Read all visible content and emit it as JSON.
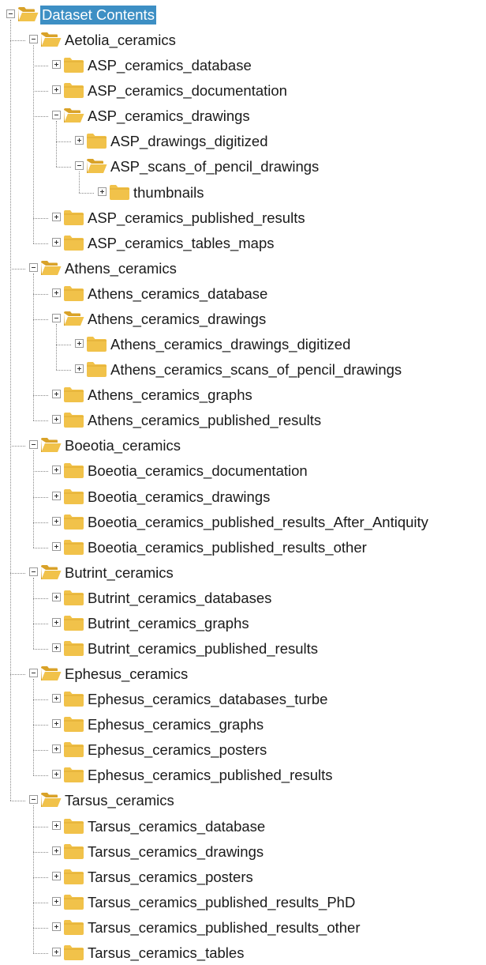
{
  "tree": {
    "label": "Dataset Contents",
    "expanded": true,
    "selected": true,
    "children": [
      {
        "label": "Aetolia_ceramics",
        "expanded": true,
        "children": [
          {
            "label": "ASP_ceramics_database"
          },
          {
            "label": "ASP_ceramics_documentation"
          },
          {
            "label": "ASP_ceramics_drawings",
            "expanded": true,
            "children": [
              {
                "label": "ASP_drawings_digitized"
              },
              {
                "label": "ASP_scans_of_pencil_drawings",
                "expanded": true,
                "children": [
                  {
                    "label": "thumbnails"
                  }
                ]
              }
            ]
          },
          {
            "label": "ASP_ceramics_published_results"
          },
          {
            "label": "ASP_ceramics_tables_maps"
          }
        ]
      },
      {
        "label": "Athens_ceramics",
        "expanded": true,
        "children": [
          {
            "label": "Athens_ceramics_database"
          },
          {
            "label": "Athens_ceramics_drawings",
            "expanded": true,
            "children": [
              {
                "label": "Athens_ceramics_drawings_digitized"
              },
              {
                "label": "Athens_ceramics_scans_of_pencil_drawings"
              }
            ]
          },
          {
            "label": "Athens_ceramics_graphs"
          },
          {
            "label": "Athens_ceramics_published_results"
          }
        ]
      },
      {
        "label": "Boeotia_ceramics",
        "expanded": true,
        "children": [
          {
            "label": "Boeotia_ceramics_documentation"
          },
          {
            "label": "Boeotia_ceramics_drawings"
          },
          {
            "label": "Boeotia_ceramics_published_results_After_Antiquity"
          },
          {
            "label": "Boeotia_ceramics_published_results_other"
          }
        ]
      },
      {
        "label": "Butrint_ceramics",
        "expanded": true,
        "children": [
          {
            "label": "Butrint_ceramics_databases"
          },
          {
            "label": "Butrint_ceramics_graphs"
          },
          {
            "label": "Butrint_ceramics_published_results"
          }
        ]
      },
      {
        "label": "Ephesus_ceramics",
        "expanded": true,
        "children": [
          {
            "label": "Ephesus_ceramics_databases_turbe"
          },
          {
            "label": "Ephesus_ceramics_graphs"
          },
          {
            "label": "Ephesus_ceramics_posters"
          },
          {
            "label": "Ephesus_ceramics_published_results"
          }
        ]
      },
      {
        "label": "Tarsus_ceramics",
        "expanded": true,
        "children": [
          {
            "label": "Tarsus_ceramics_database"
          },
          {
            "label": "Tarsus_ceramics_drawings"
          },
          {
            "label": "Tarsus_ceramics_posters"
          },
          {
            "label": "Tarsus_ceramics_published_results_PhD"
          },
          {
            "label": "Tarsus_ceramics_published_results_other"
          },
          {
            "label": "Tarsus_ceramics_tables"
          }
        ]
      }
    ]
  },
  "colors": {
    "folder": "#f1c24a",
    "folder_dark": "#d9a228",
    "selection": "#3d8fc4"
  }
}
